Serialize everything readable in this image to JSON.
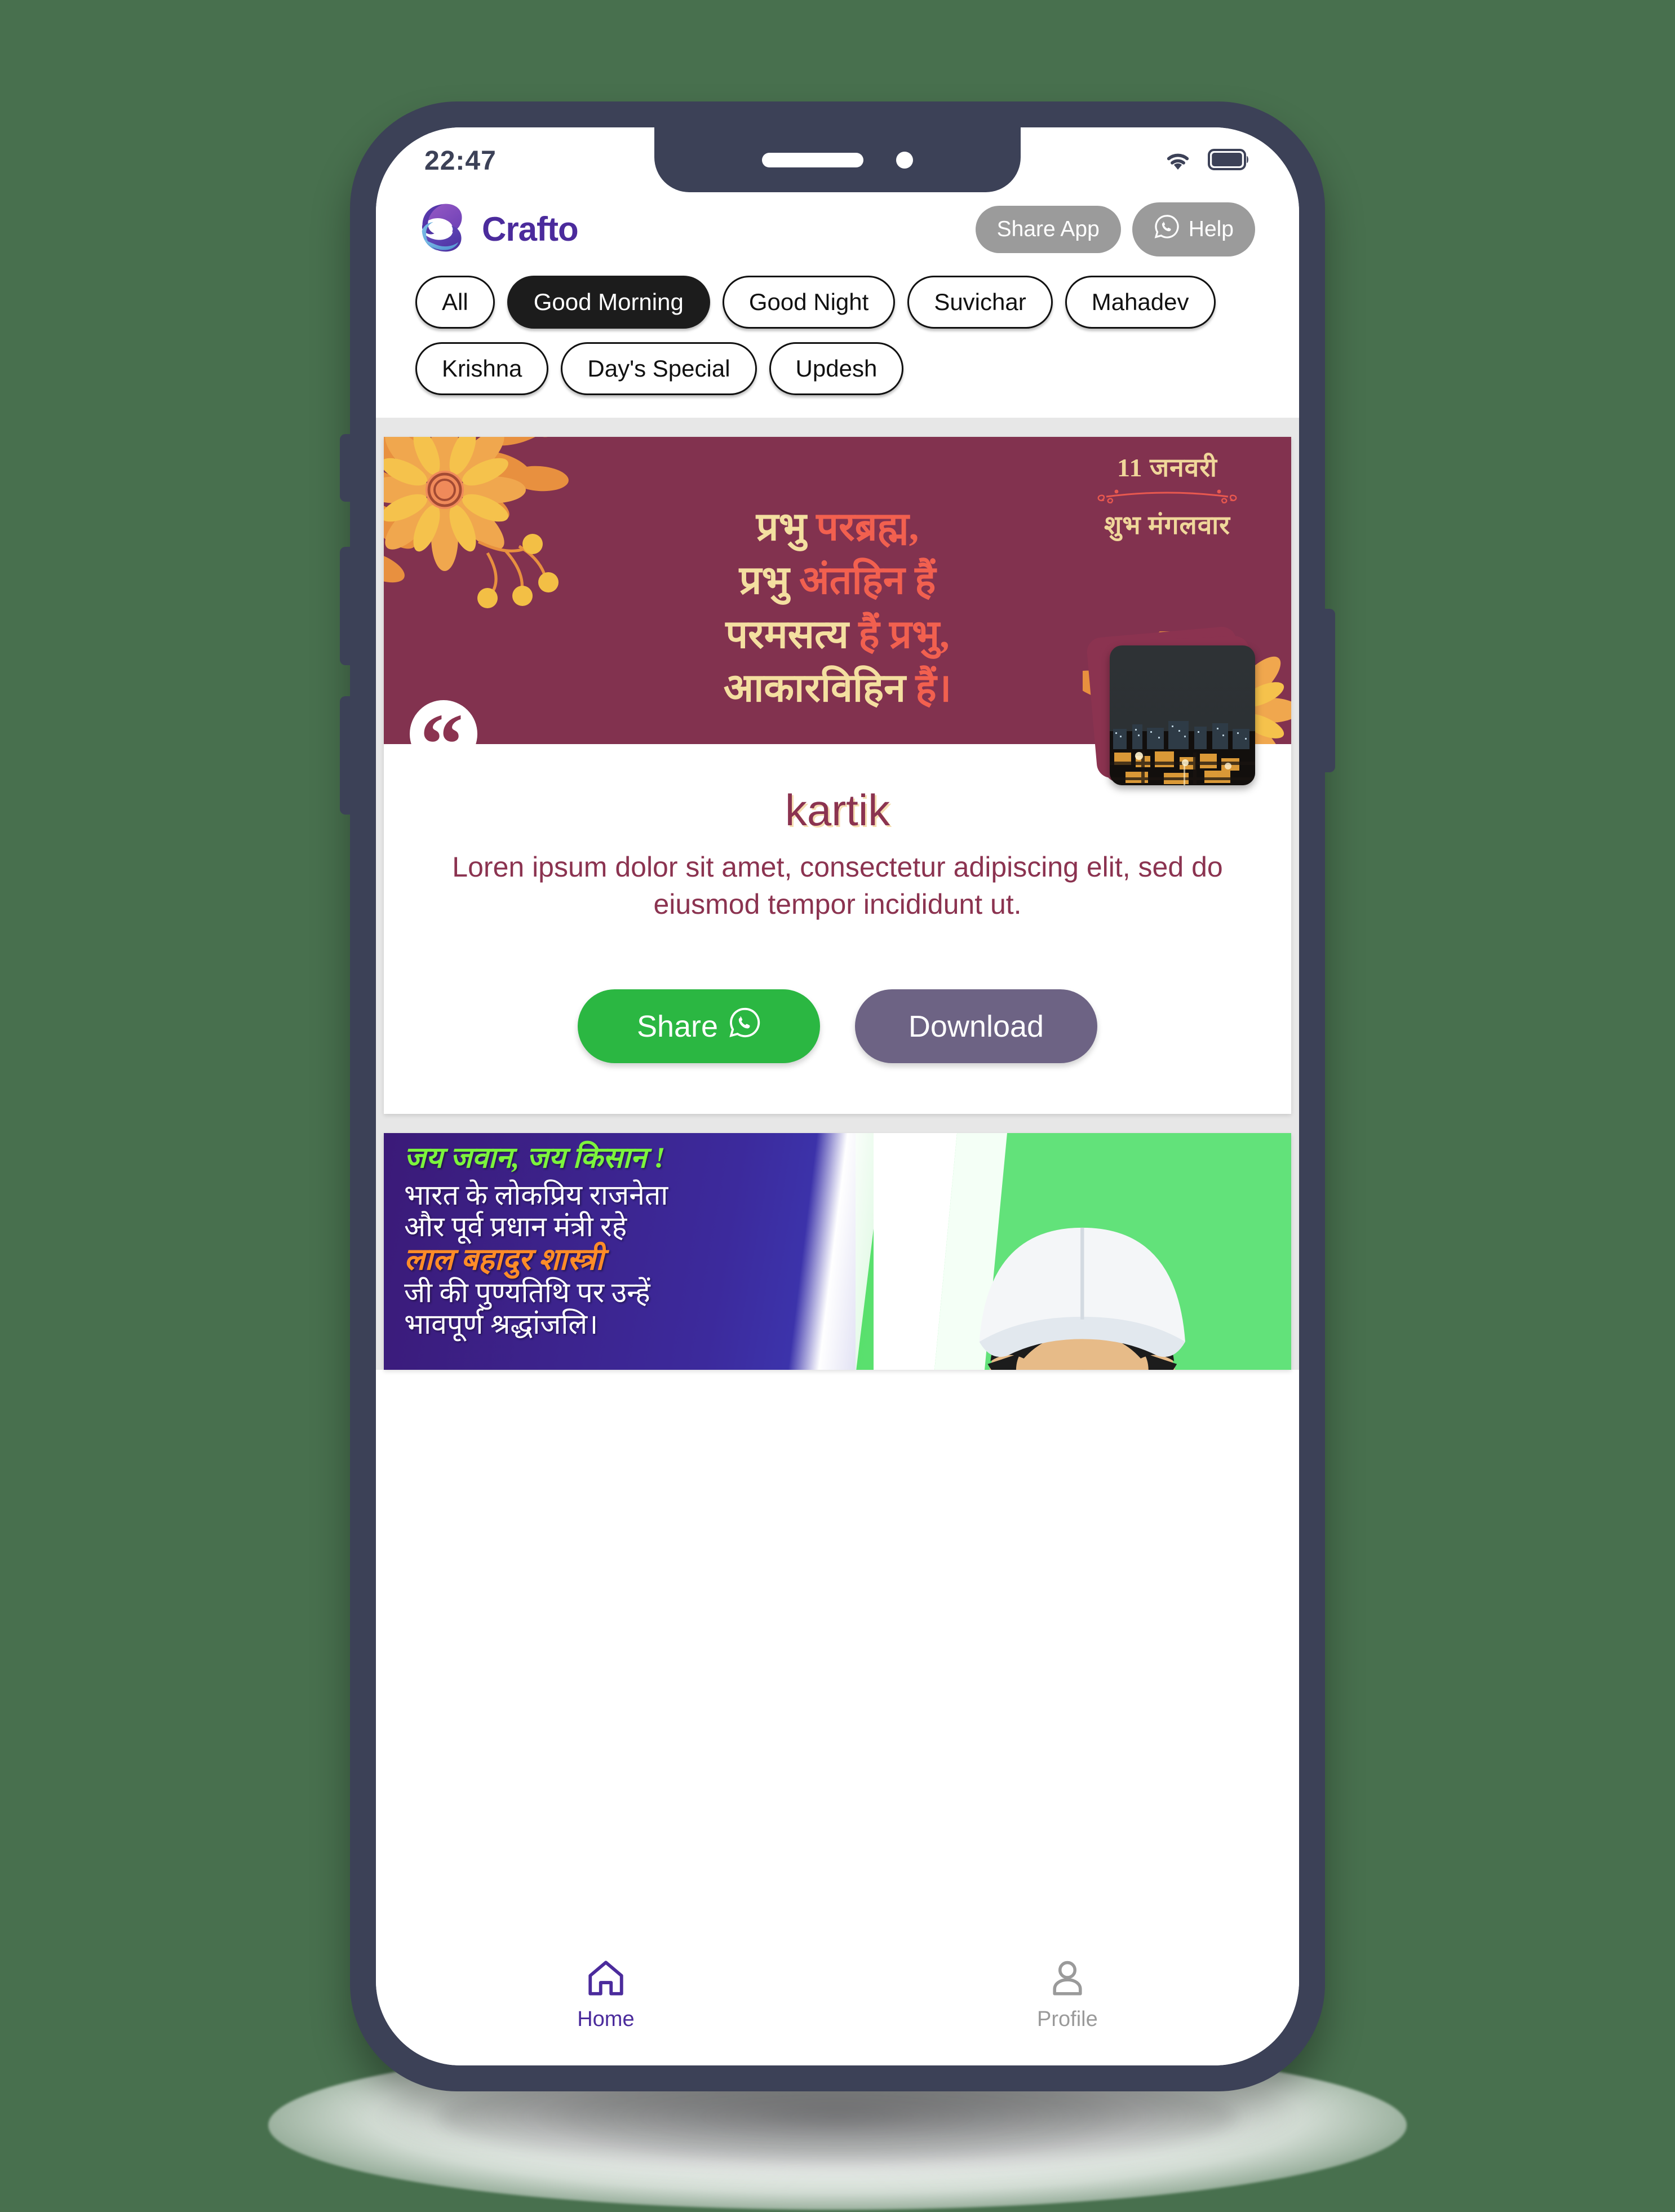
{
  "background_color": "#48704e",
  "status_bar": {
    "time": "22:47",
    "wifi_icon": "wifi-icon",
    "battery_icon": "battery-full-icon"
  },
  "header": {
    "brand_name": "Crafto",
    "logo_icon": "crafto-logo-icon",
    "share_app_label": "Share App",
    "help_label": "Help",
    "help_icon": "whatsapp-icon",
    "button_color": "#9b9b9b",
    "brand_color": "#4b2b9c"
  },
  "chips": {
    "active_index": 1,
    "items": [
      {
        "label": "All"
      },
      {
        "label": "Good Morning"
      },
      {
        "label": "Good Night"
      },
      {
        "label": "Suvichar"
      },
      {
        "label": "Mahadev"
      },
      {
        "label": "Krishna"
      },
      {
        "label": "Day's Special"
      },
      {
        "label": "Updesh"
      }
    ]
  },
  "quote_card": {
    "bg_color": "#82324f",
    "date_day": "11 जनवरी",
    "date_weekday": "शुभ मंगलवार",
    "date_color": "#f0d79a",
    "lines": [
      {
        "yellow": "प्रभु ",
        "red": "परब्रह्म,"
      },
      {
        "yellow": "प्रभु ",
        "red": "अंतहिन हैं"
      },
      {
        "yellow": "परमसत्य ",
        "red": "हैं प्रभु,"
      },
      {
        "yellow": "आकारविहिन ",
        "red": "हैं।"
      }
    ],
    "yellow_color": "#f4dfa0",
    "red_color": "#f2604f",
    "quote_mark": "“",
    "author": "kartik",
    "description": "Loren ipsum dolor sit amet, consectetur adipiscing elit, sed do eiusmod tempor incididunt ut.",
    "thumbnail_alt": "night-cityscape-photo",
    "share_label": "Share",
    "share_icon": "whatsapp-icon",
    "share_color": "#2bb742",
    "download_label": "Download",
    "download_color": "#6d6384"
  },
  "banner_card": {
    "heading": "जय जवान, जय किसान !",
    "line1": "भारत के लोकप्रिय राजनेता",
    "line2": "और पूर्व प्रधान मंत्री रहे",
    "name": "लाल बहादुर शास्त्री",
    "line3": "जी की पुण्यतिथि पर उन्हें",
    "line4": "भावपूर्ण श्रद्धांजलि।",
    "heading_color": "#7cf43d",
    "name_color": "#ff8c28",
    "portrait_alt": "lal-bahadur-shastri-portrait"
  },
  "bottom_nav": {
    "items": [
      {
        "label": "Home",
        "icon": "home-icon",
        "active": true
      },
      {
        "label": "Profile",
        "icon": "user-icon",
        "active": false
      }
    ],
    "active_color": "#4b2b9c",
    "inactive_color": "#9a9a9a"
  }
}
